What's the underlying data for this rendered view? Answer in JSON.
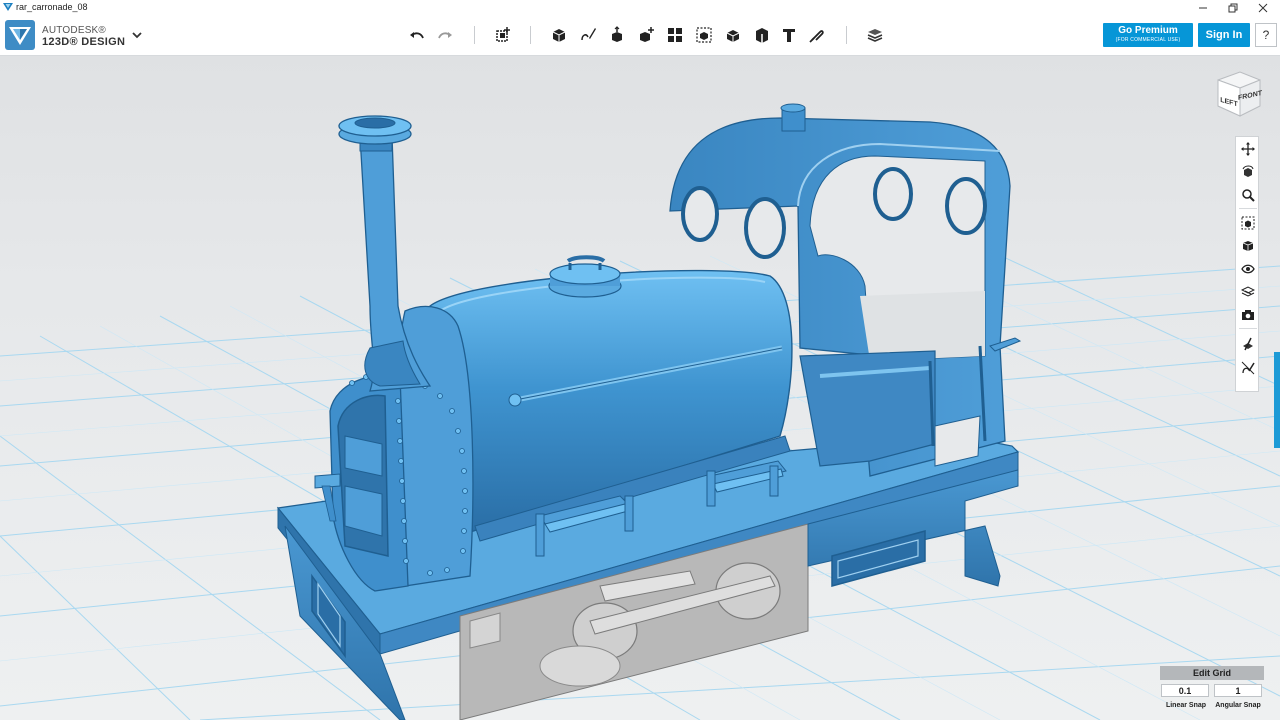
{
  "window": {
    "title": "rar_carronade_08",
    "app_icon": "autodesk-v-icon",
    "controls": [
      "minimize-icon",
      "maximize-icon",
      "close-icon"
    ]
  },
  "brand": {
    "company": "AUTODESK®",
    "product": "123D® DESIGN",
    "menu_icon": "chevron-down-icon"
  },
  "toolbar": {
    "tools": [
      {
        "name": "undo",
        "icon": "undo-icon"
      },
      {
        "name": "redo",
        "icon": "redo-icon"
      },
      {
        "name": "transform",
        "icon": "transform-icon"
      },
      {
        "name": "primitives",
        "icon": "primitive-box-icon"
      },
      {
        "name": "sketch",
        "icon": "sketch-icon"
      },
      {
        "name": "construct",
        "icon": "construct-icon"
      },
      {
        "name": "modify",
        "icon": "modify-icon"
      },
      {
        "name": "pattern",
        "icon": "pattern-icon"
      },
      {
        "name": "grouping",
        "icon": "group-icon"
      },
      {
        "name": "combine",
        "icon": "combine-icon"
      },
      {
        "name": "measure",
        "icon": "measure-icon"
      },
      {
        "name": "text",
        "icon": "text-icon"
      },
      {
        "name": "snap",
        "icon": "snap-icon"
      },
      {
        "name": "material",
        "icon": "material-icon"
      }
    ],
    "premium_label": "Go Premium",
    "premium_sub": "(FOR COMMERCIAL USE)",
    "signin_label": "Sign In",
    "help_label": "?"
  },
  "viewcube": {
    "left_face": "LEFT",
    "front_face": "FRONT"
  },
  "navbar": {
    "items": [
      {
        "name": "pan",
        "icon": "pan-icon"
      },
      {
        "name": "orbit",
        "icon": "orbit-icon"
      },
      {
        "name": "zoom",
        "icon": "zoom-icon"
      },
      {
        "name": "fit",
        "icon": "fit-icon"
      },
      {
        "name": "views",
        "icon": "view-cube-icon"
      },
      {
        "name": "visibility",
        "icon": "eye-icon"
      },
      {
        "name": "materials",
        "icon": "material-outline-icon"
      },
      {
        "name": "snapshot",
        "icon": "camera-icon"
      },
      {
        "name": "show-hide",
        "icon": "show-hide-icon"
      },
      {
        "name": "hide-sketch",
        "icon": "hide-sketch-icon"
      }
    ]
  },
  "grid": {
    "edit_label": "Edit Grid",
    "linear_value": "0.1",
    "linear_label": "Linear Snap",
    "angular_value": "1",
    "angular_label": "Angular Snap"
  },
  "colors": {
    "accent": "#0696d7",
    "model_blue": "#3f8fcc",
    "model_blue_light": "#66b6ec",
    "model_blue_dark": "#1f5f91",
    "chassis_gray": "#a9a9a9",
    "grid_line": "#9fd3ee",
    "grid_bg": "#eef0f1"
  }
}
